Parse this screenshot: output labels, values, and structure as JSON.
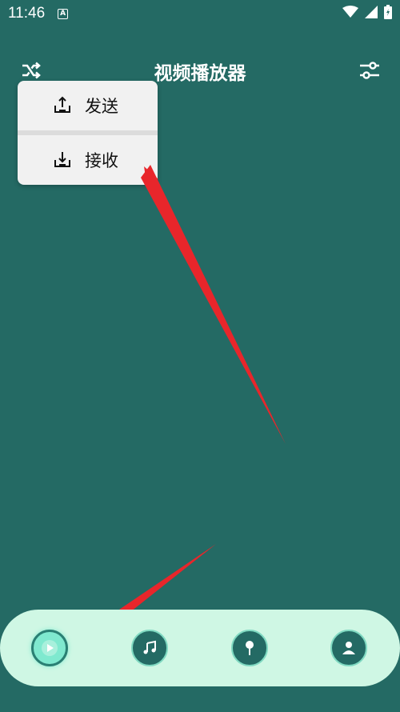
{
  "status_bar": {
    "time": "11:46",
    "notification_icon": "A"
  },
  "header": {
    "title": "视频播放器",
    "left_icon": "shuffle-icon",
    "right_icon": "sliders-icon"
  },
  "popup_menu": {
    "items": [
      {
        "label": "发送",
        "icon": "upload-icon"
      },
      {
        "label": "接收",
        "icon": "download-icon"
      }
    ]
  },
  "bottom_nav": {
    "items": [
      {
        "icon": "play-icon",
        "active": true
      },
      {
        "icon": "music-note-icon",
        "active": false
      },
      {
        "icon": "microphone-icon",
        "active": false
      },
      {
        "icon": "person-icon",
        "active": false
      }
    ]
  },
  "colors": {
    "background": "#246a64",
    "nav_bar": "#cff7e4",
    "accent": "#7fe9cf",
    "annotation_arrow": "#e8262b"
  }
}
